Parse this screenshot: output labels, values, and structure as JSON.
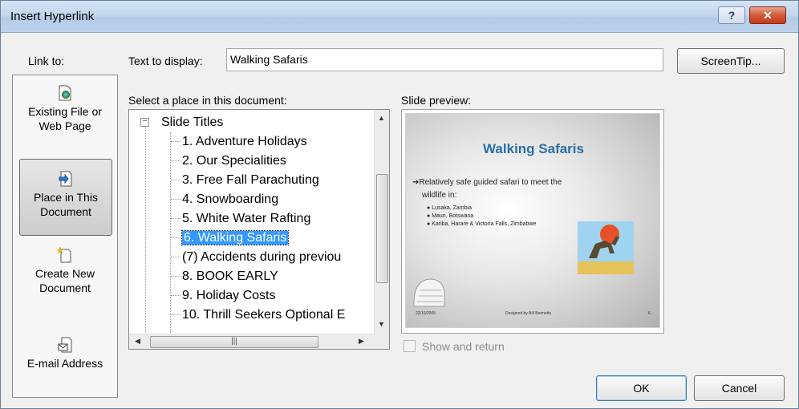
{
  "window": {
    "title": "Insert Hyperlink",
    "help_label": "?",
    "close_label": "✕"
  },
  "link_to": {
    "label": "Link to:",
    "items": [
      {
        "line1": "Existing File or",
        "line2": "Web Page",
        "icon": "file-globe-icon"
      },
      {
        "line1": "Place in This",
        "line2": "Document",
        "icon": "document-place-icon",
        "selected": true
      },
      {
        "line1": "Create New",
        "line2": "Document",
        "icon": "new-document-icon"
      },
      {
        "line1": "E-mail Address",
        "line2": "",
        "icon": "email-icon"
      }
    ]
  },
  "text_to_display": {
    "label": "Text to display:",
    "value": "Walking Safaris"
  },
  "screentip_label": "ScreenTip...",
  "place": {
    "label": "Select a place in this document:",
    "root": "Slide Titles",
    "items": [
      "1. Adventure Holidays",
      "2. Our Specialities",
      "3. Free Fall Parachuting",
      "4. Snowboarding",
      "5. White Water Rafting",
      "6. Walking Safaris",
      "(7) Accidents during previou",
      "8. BOOK EARLY",
      "9. Holiday Costs",
      "10. Thrill Seekers Optional E"
    ],
    "selected_index": 5
  },
  "preview": {
    "label": "Slide preview:",
    "slide_title": "Walking Safaris",
    "bullet_line1": "Relatively safe guided safari to meet the",
    "bullet_line2": "wildlife in:",
    "sub_bullets": [
      "Lusaka, Zambia",
      "Maun, Botswana",
      "Kariba, Harare & Victoria Falls, Zimbabwe"
    ],
    "footer_date": "22/10/2005",
    "footer_author": "Designed by Bill Bennetts",
    "footer_page": "6"
  },
  "show_and_return": {
    "label": "Show and return",
    "checked": false
  },
  "buttons": {
    "ok": "OK",
    "cancel": "Cancel"
  },
  "colors": {
    "selection": "#3399ff",
    "slide_title": "#2b6fa5"
  }
}
